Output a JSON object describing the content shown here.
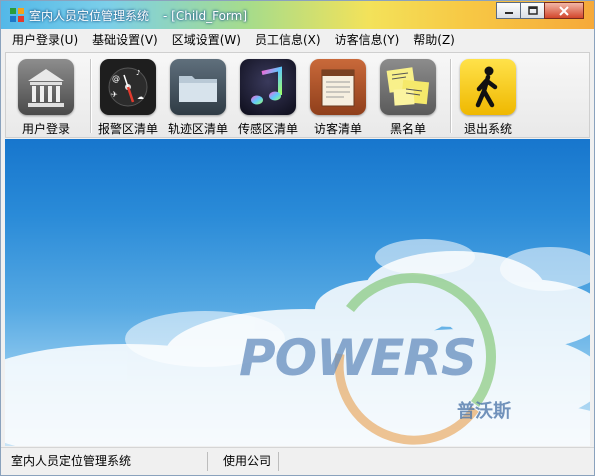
{
  "window": {
    "title": "室内人员定位管理系统",
    "subtitle": "- [Child_Form]"
  },
  "menu": [
    {
      "label": "用户登录(U)"
    },
    {
      "label": "基础设置(V)"
    },
    {
      "label": "区域设置(W)"
    },
    {
      "label": "员工信息(X)"
    },
    {
      "label": "访客信息(Y)"
    },
    {
      "label": "帮助(Z)"
    }
  ],
  "toolbar": {
    "items": [
      {
        "label": "用户登录",
        "icon": "bank-icon"
      },
      {
        "label": "报警区清单",
        "icon": "dashboard-icon"
      },
      {
        "label": "轨迹区清单",
        "icon": "folder-icon"
      },
      {
        "label": "传感区清单",
        "icon": "music-note-icon"
      },
      {
        "label": "访客清单",
        "icon": "notepad-icon"
      },
      {
        "label": "黑名单",
        "icon": "sticky-notes-icon"
      },
      {
        "label": "退出系统",
        "icon": "walking-person-icon"
      }
    ]
  },
  "watermark": {
    "brand": "POWERS",
    "sub": "普沃斯"
  },
  "status": {
    "app_name": "室内人员定位管理系统",
    "company": "使用公司"
  },
  "colors": {
    "sky_top": "#1776cd",
    "sky_bottom": "#c9e4f6",
    "exit_icon_bg": "#f6d21a"
  }
}
